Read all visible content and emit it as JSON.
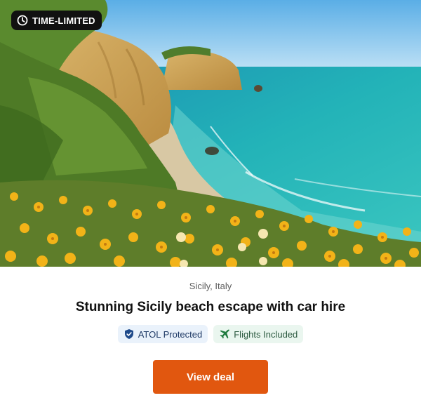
{
  "badge": {
    "label": "TIME-LIMITED",
    "icon": "clock-icon"
  },
  "hero": {
    "alt": "Coastal cliffs with yellow wildflowers and turquoise sea"
  },
  "deal": {
    "location": "Sicily, Italy",
    "title": "Stunning Sicily beach escape with car hire"
  },
  "tags": [
    {
      "label": "ATOL Protected",
      "icon": "shield-icon",
      "color": "#1f4a8a"
    },
    {
      "label": "Flights Included",
      "icon": "plane-icon",
      "color": "#1e7a3e"
    }
  ],
  "cta": {
    "label": "View deal",
    "color": "#e1570f"
  }
}
